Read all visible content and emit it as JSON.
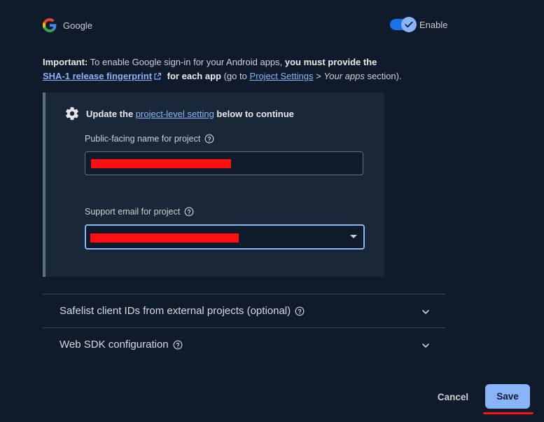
{
  "provider": {
    "name": "Google",
    "icon": "google-g-logo-icon"
  },
  "toggle": {
    "label": "Enable",
    "enabled": true
  },
  "info": {
    "important_label": "Important:",
    "text_1": " To enable Google sign-in for your Android apps, ",
    "bold_1": "you must provide the",
    "link_sha": "SHA-1 release fingerprint",
    "bold_2": " for each app",
    "text_2": " (go to ",
    "link_project_settings": "Project Settings",
    "text_3": " > ",
    "italic_your_apps": "Your apps",
    "text_4": " section)."
  },
  "setting_box": {
    "header_prefix": "Update the ",
    "header_link": "project-level setting",
    "header_suffix": " below to continue",
    "public_name_label": "Public-facing name for project",
    "support_email_label": "Support email for project"
  },
  "accordions": [
    {
      "title": "Safelist client IDs from external projects (optional)"
    },
    {
      "title": "Web SDK configuration"
    }
  ],
  "actions": {
    "cancel": "Cancel",
    "save": "Save"
  },
  "colors": {
    "accent": "#8ab4f8",
    "toggle_track": "#1a73e8",
    "background": "#0f1b2b",
    "redaction": "#ff0f0f"
  }
}
